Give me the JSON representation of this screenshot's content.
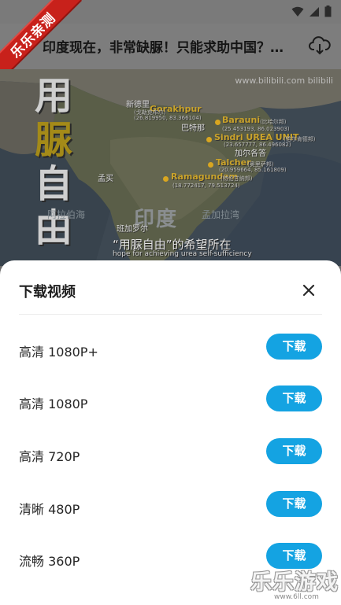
{
  "status_bar": {
    "icons": [
      "wifi-icon",
      "signal-icon",
      "battery-icon"
    ]
  },
  "header": {
    "ribbon_text": "乐乐亲测",
    "video_title": "印度现在，非常缺脲！只能求助中国？…",
    "download_icon": "cloud-download-icon"
  },
  "video": {
    "big_chars": [
      "用",
      "脲",
      "自",
      "由"
    ],
    "watermark": "www.bilibili.com  bilibili",
    "country": "印度",
    "cities": [
      {
        "name": "新德里"
      },
      {
        "name": "Gorakhpur",
        "tag": "(戈勒克布尔)",
        "coords": "(26.819950, 83.366104)"
      },
      {
        "name": "巴特那"
      },
      {
        "name": "Barauni",
        "tag": "(比哈尔邦)",
        "coords": "(25.453193, 86.023903)"
      },
      {
        "name": "Sindri  UREA UNIT",
        "tag": "(恰尔肯德邦)",
        "coords": "(23.657777, 86.496082)"
      },
      {
        "name": "加尔各答"
      },
      {
        "name": "Talcher",
        "tag": "(奥里萨邦)",
        "coords": "(20.959664, 85.161809)"
      },
      {
        "name": "孟买"
      },
      {
        "name": "Ramagundam",
        "tag": "(特伦甘纳邦)",
        "coords": "(18.772417, 79.513724)"
      },
      {
        "name": "班加罗尔"
      }
    ],
    "regions": [
      "阿拉伯海",
      "孟加拉湾"
    ],
    "subtitle_cn": "“用脲自由”的希望所在",
    "subtitle_en": "hope for achieving urea self-sufficiency"
  },
  "sheet": {
    "title": "下载视频",
    "close_icon": "close-icon",
    "options": [
      {
        "quality": "高清 1080P+",
        "button": "下载"
      },
      {
        "quality": "高清 1080P",
        "button": "下载"
      },
      {
        "quality": "高清 720P",
        "button": "下载"
      },
      {
        "quality": "清晰 480P",
        "button": "下载"
      },
      {
        "quality": "流畅 360P",
        "button": "下载"
      }
    ]
  },
  "brand_watermark": {
    "name": "乐乐游戏",
    "url": "www.6ll.com"
  },
  "colors": {
    "accent": "#14a3e2",
    "ribbon": "#c8211b",
    "dim_overlay": "#7d7d7d"
  }
}
